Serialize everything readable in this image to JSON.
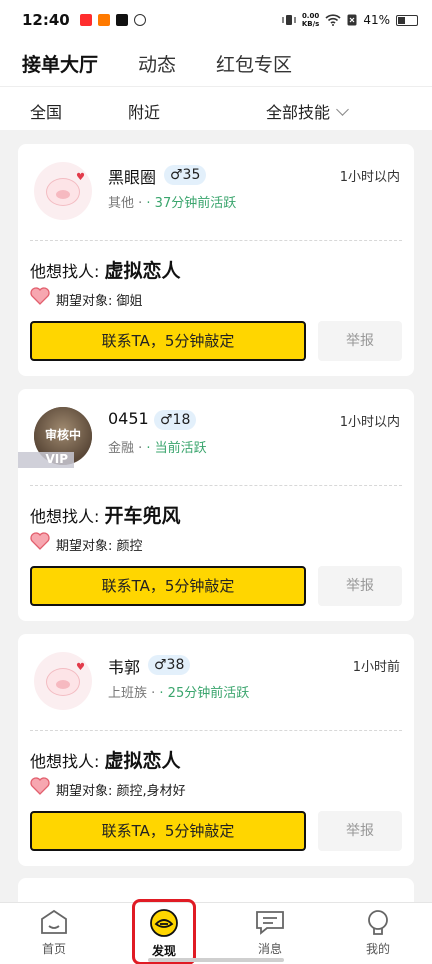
{
  "status_bar": {
    "time": "12:40",
    "net_speed_value": "0.00",
    "net_speed_unit": "KB/s",
    "battery": "41%"
  },
  "top_tabs": [
    {
      "label": "接单大厅",
      "active": true
    },
    {
      "label": "动态",
      "active": false
    },
    {
      "label": "红包专区",
      "active": false
    }
  ],
  "filters": {
    "region": "全国",
    "nearby": "附近",
    "skills": "全部技能"
  },
  "cards": [
    {
      "name": "黑眼圈",
      "age": "♂35",
      "category": "其他 ·",
      "activity": "· 37分钟前活跃",
      "time": "1小时以内",
      "want_prefix": "他想找人:",
      "want_value": "虚拟恋人",
      "expect": "期望对象: 御姐",
      "contact_button": "联系TA，5分钟敲定",
      "report_button": "举报"
    },
    {
      "name": "0451",
      "age": "♂18",
      "category": "金融 ·",
      "activity": "· 当前活跃",
      "time": "1小时以内",
      "avatar_overlay": "审核中",
      "vip": "VIP",
      "want_prefix": "他想找人:",
      "want_value": "开车兜风",
      "expect": "期望对象: 颜控",
      "contact_button": "联系TA，5分钟敲定",
      "report_button": "举报"
    },
    {
      "name": "韦郭",
      "age": "♂38",
      "category": "上班族 ·",
      "activity": "· 25分钟前活跃",
      "time": "1小时前",
      "want_prefix": "他想找人:",
      "want_value": "虚拟恋人",
      "expect": "期望对象: 颜控,身材好",
      "contact_button": "联系TA，5分钟敲定",
      "report_button": "举报"
    }
  ],
  "bottom_nav": [
    {
      "label": "首页",
      "icon": "home-icon"
    },
    {
      "label": "发现",
      "icon": "discover-eye-icon",
      "active": true
    },
    {
      "label": "消息",
      "icon": "message-icon"
    },
    {
      "label": "我的",
      "icon": "profile-icon"
    }
  ],
  "colors": {
    "accent": "#ffd600",
    "active_green": "#3aa56d",
    "highlight_red": "#e01b24"
  }
}
